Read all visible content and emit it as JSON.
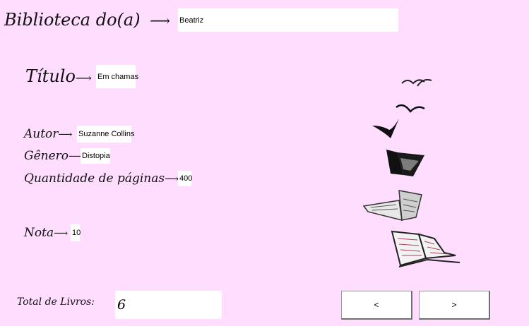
{
  "header": {
    "library_label": "Biblioteca do(a)",
    "arrow": "⟶",
    "owner_name": "Beatriz"
  },
  "book": {
    "title_label": "Título",
    "title_value": "Em chamas",
    "author_label": "Autor",
    "author_value": "Suzanne Collins",
    "genre_label": "Gênero",
    "genre_value": "Distopia",
    "pages_label": "Quantidade de páginas",
    "pages_value": "400",
    "rating_label": "Nota",
    "rating_value": "10"
  },
  "footer": {
    "total_label": "Total de Livros:",
    "total_value": "6",
    "prev_label": "<",
    "next_label": ">"
  },
  "icons": {
    "illustration": "flying-books-illustration"
  },
  "colors": {
    "background": "#FFDDFF",
    "field": "#FFFFFF"
  }
}
